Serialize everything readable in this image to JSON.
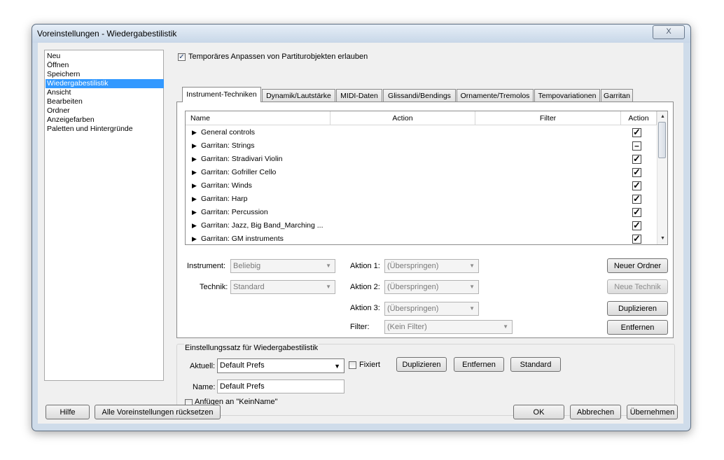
{
  "window": {
    "title": "Voreinstellungen - Wiedergabestilistik",
    "close_label": "X"
  },
  "categories": [
    "Neu",
    "Öffnen",
    "Speichern",
    "Wiedergabestilistik",
    "Ansicht",
    "Bearbeiten",
    "Ordner",
    "Anzeigefarben",
    "Paletten und Hintergründe"
  ],
  "selected_category": "Wiedergabestilistik",
  "temp_adjust": {
    "label": "Temporäres Anpassen von Partiturobjekten erlauben",
    "checked": true
  },
  "tabs": [
    "Instrument-Techniken",
    "Dynamik/Lautstärke",
    "MIDI-Daten",
    "Glissandi/Bendings",
    "Ornamente/Tremolos",
    "Tempovariationen",
    "Garritan"
  ],
  "active_tab": "Instrument-Techniken",
  "table": {
    "columns": [
      "Name",
      "Action",
      "Filter",
      "Action"
    ],
    "rows": [
      {
        "name": "General controls",
        "state": "checked"
      },
      {
        "name": "Garritan: Strings",
        "state": "partial"
      },
      {
        "name": "Garritan: Stradivari Violin",
        "state": "checked"
      },
      {
        "name": "Garritan: Gofriller Cello",
        "state": "checked"
      },
      {
        "name": "Garritan: Winds",
        "state": "checked"
      },
      {
        "name": "Garritan: Harp",
        "state": "checked"
      },
      {
        "name": "Garritan: Percussion",
        "state": "checked"
      },
      {
        "name": "Garritan: Jazz, Big Band_Marching ...",
        "state": "checked"
      },
      {
        "name": "Garritan: GM instruments",
        "state": "checked"
      }
    ]
  },
  "form": {
    "instrument_label": "Instrument:",
    "instrument_value": "Beliebig",
    "technik_label": "Technik:",
    "technik_value": "Standard",
    "aktion1_label": "Aktion 1:",
    "aktion1_value": "(Überspringen)",
    "aktion2_label": "Aktion 2:",
    "aktion2_value": "(Überspringen)",
    "aktion3_label": "Aktion 3:",
    "aktion3_value": "(Überspringen)",
    "filter_label": "Filter:",
    "filter_value": "(Kein Filter)"
  },
  "side_buttons": {
    "new_folder": "Neuer Ordner",
    "new_technik": "Neue Technik",
    "duplicate": "Duplizieren",
    "remove": "Entfernen"
  },
  "settings_set": {
    "group_title": "Einstellungssatz für Wiedergabestilistik",
    "current_label": "Aktuell:",
    "current_value": "Default Prefs",
    "fixed_label": "Fixiert",
    "duplicate": "Duplizieren",
    "remove": "Entfernen",
    "standard": "Standard",
    "name_label": "Name:",
    "name_value": "Default Prefs",
    "append_label": "Anfügen an \"KeinName\""
  },
  "footer": {
    "help": "Hilfe",
    "reset_all": "Alle Voreinstellungen rücksetzen",
    "ok": "OK",
    "cancel": "Abbrechen",
    "apply": "Übernehmen"
  }
}
